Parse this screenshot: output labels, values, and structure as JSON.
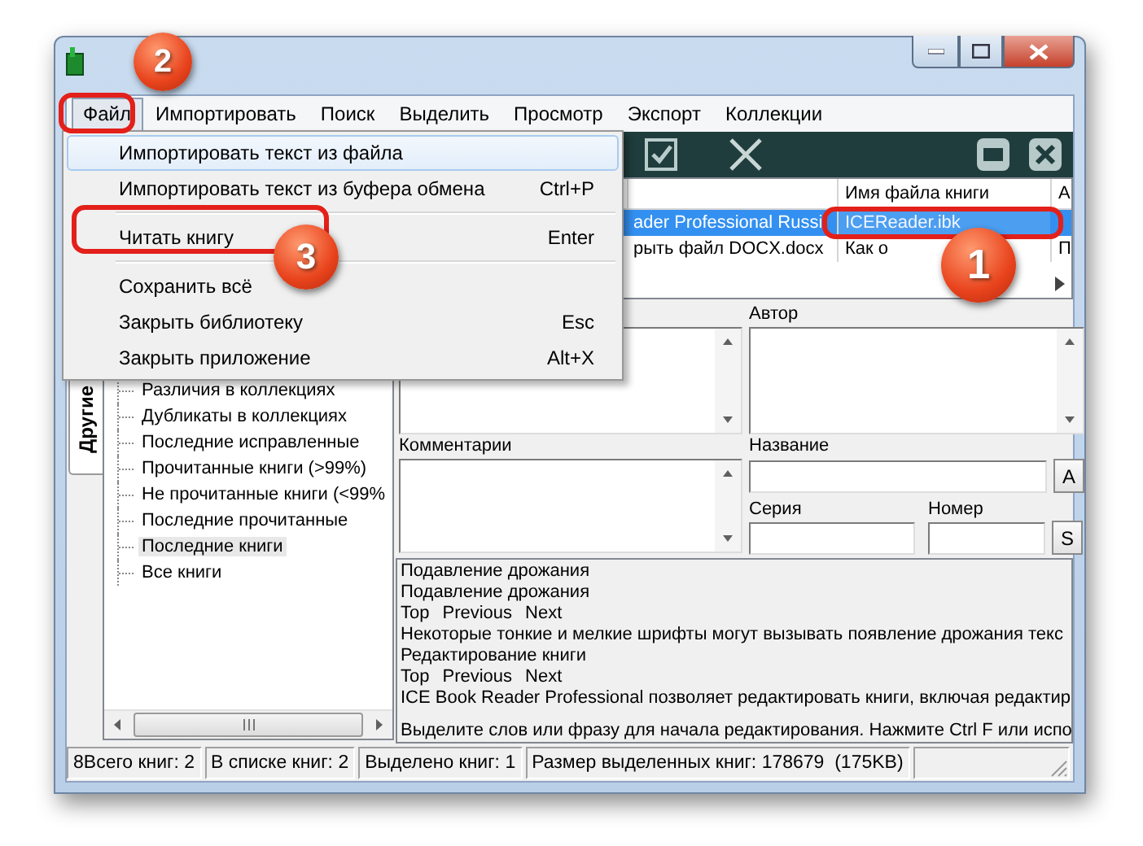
{
  "menubar": [
    {
      "label": "Файл",
      "selected": true
    },
    {
      "label": "Импортировать",
      "selected": false
    },
    {
      "label": "Поиск",
      "selected": false
    },
    {
      "label": "Выделить",
      "selected": false
    },
    {
      "label": "Просмотр",
      "selected": false
    },
    {
      "label": "Экспорт",
      "selected": false
    },
    {
      "label": "Коллекции",
      "selected": false
    }
  ],
  "file_menu": [
    {
      "kind": "item",
      "label": "Импортировать текст из файла",
      "selected": true
    },
    {
      "kind": "item",
      "label": "Импортировать текст из буфера обмена",
      "shortcut": "Ctrl+P",
      "selected": false
    },
    {
      "kind": "separator"
    },
    {
      "kind": "item",
      "label": "Читать книгу",
      "shortcut": "Enter",
      "selected": false
    },
    {
      "kind": "separator"
    },
    {
      "kind": "item",
      "label": "Сохранить всё",
      "selected": false
    },
    {
      "kind": "item",
      "label": "Закрыть библиотеку",
      "shortcut": "Esc",
      "selected": false
    },
    {
      "kind": "item",
      "label": "Закрыть приложение",
      "shortcut": "Alt+X",
      "selected": false
    }
  ],
  "side_tabs": [
    {
      "label": "Другие",
      "selected": true
    }
  ],
  "tree": [
    {
      "label": "Различия в коллекциях",
      "selected": false
    },
    {
      "label": "Дубликаты в коллекциях",
      "selected": false
    },
    {
      "label": "Последние исправленные",
      "selected": false
    },
    {
      "label": "Прочитанные книги (>99%)",
      "selected": false
    },
    {
      "label": "Не прочитанные книги (<99%",
      "selected": false
    },
    {
      "label": "Последние прочитанные",
      "selected": false
    },
    {
      "label": "Последние книги",
      "selected": true
    },
    {
      "label": "Все книги",
      "selected": false
    }
  ],
  "table": {
    "columns": [
      {
        "label": "Имя файла книги"
      },
      {
        "label": "А"
      }
    ],
    "rows": [
      {
        "title": "ader Professional Russi",
        "file": "ICEReader.ibk",
        "selected": true
      },
      {
        "title": "рыть файл DOCX.docx",
        "file": "Как о",
        "column_3": "П",
        "selected": false
      }
    ]
  },
  "form": {
    "author_label": "Автор",
    "comments_label": "Комментарии",
    "title_label": "Название",
    "title_button": "A",
    "series_label": "Серия",
    "number_label": "Номер",
    "series_button": "S"
  },
  "text_lines": [
    {
      "kind": "text",
      "text": "Подавление дрожания"
    },
    {
      "kind": "text",
      "text": "Подавление дрожания"
    },
    {
      "kind": "links",
      "links": [
        "Top",
        "Previous",
        "Next"
      ]
    },
    {
      "kind": "text",
      "text": "Некоторые тонкие и мелкие шрифты могут вызывать появление дрожания текс"
    },
    {
      "kind": "text",
      "text": "Редактирование книги"
    },
    {
      "kind": "links",
      "links": [
        "Top",
        "Previous",
        "Next"
      ]
    },
    {
      "kind": "text",
      "text": "ICE Book Reader Professional позволяет редактировать книги, включая редактир"
    },
    {
      "kind": "blank"
    },
    {
      "kind": "text",
      "text": "Выделите слов или фразу для начала редактирования. Нажмите Ctrl F или испо"
    }
  ],
  "status_bar": [
    "8Всего книг: 2",
    "В списке книг: 2",
    "Выделено книг: 1",
    "Размер выделенных книг: 178679  (175KB)"
  ],
  "annotations": [
    {
      "number": "1"
    },
    {
      "number": "2"
    },
    {
      "number": "3"
    }
  ]
}
